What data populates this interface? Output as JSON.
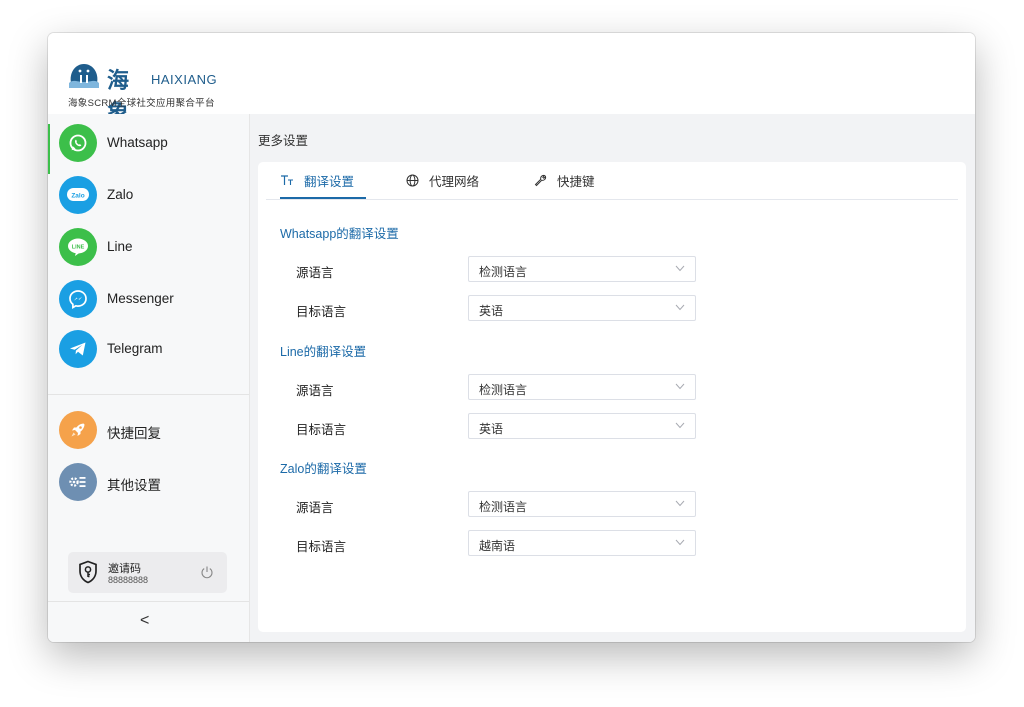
{
  "app": {
    "logo_cn": "海象",
    "logo_en": "HAIXIANG",
    "logo_subtitle": "海象SCRM全球社交应用聚合平台"
  },
  "sidebar": {
    "items": [
      {
        "label": "Whatsapp",
        "icon": "whatsapp-icon",
        "color": "#3cbf4a",
        "active": true
      },
      {
        "label": "Zalo",
        "icon": "zalo-icon",
        "color": "#1a9fe3"
      },
      {
        "label": "Line",
        "icon": "line-icon",
        "color": "#3cbf4a"
      },
      {
        "label": "Messenger",
        "icon": "messenger-icon",
        "color": "#1a9fe3"
      },
      {
        "label": "Telegram",
        "icon": "telegram-icon",
        "color": "#1a9fe3"
      }
    ],
    "tools": [
      {
        "label": "快捷回复",
        "icon": "rocket-icon",
        "color": "#f5a24b"
      },
      {
        "label": "其他设置",
        "icon": "settings-icon",
        "color": "#6e8fb2"
      }
    ],
    "invite": {
      "title": "邀请码",
      "code": "88888888"
    },
    "collapse_glyph": "<"
  },
  "main": {
    "title": "更多设置",
    "tabs": [
      {
        "label": "翻译设置",
        "icon": "text-size-icon",
        "active": true
      },
      {
        "label": "代理网络",
        "icon": "globe-icon"
      },
      {
        "label": "快捷键",
        "icon": "wrench-icon"
      }
    ],
    "sections": [
      {
        "title": "Whatsapp的翻译设置",
        "source_label": "源语言",
        "source_value": "检测语言",
        "target_label": "目标语言",
        "target_value": "英语"
      },
      {
        "title": "Line的翻译设置",
        "source_label": "源语言",
        "source_value": "检测语言",
        "target_label": "目标语言",
        "target_value": "英语"
      },
      {
        "title": "Zalo的翻译设置",
        "source_label": "源语言",
        "source_value": "检测语言",
        "target_label": "目标语言",
        "target_value": "越南语"
      }
    ]
  },
  "colors": {
    "accent": "#1c6aa8",
    "active_indicator": "#3cbf4a"
  }
}
